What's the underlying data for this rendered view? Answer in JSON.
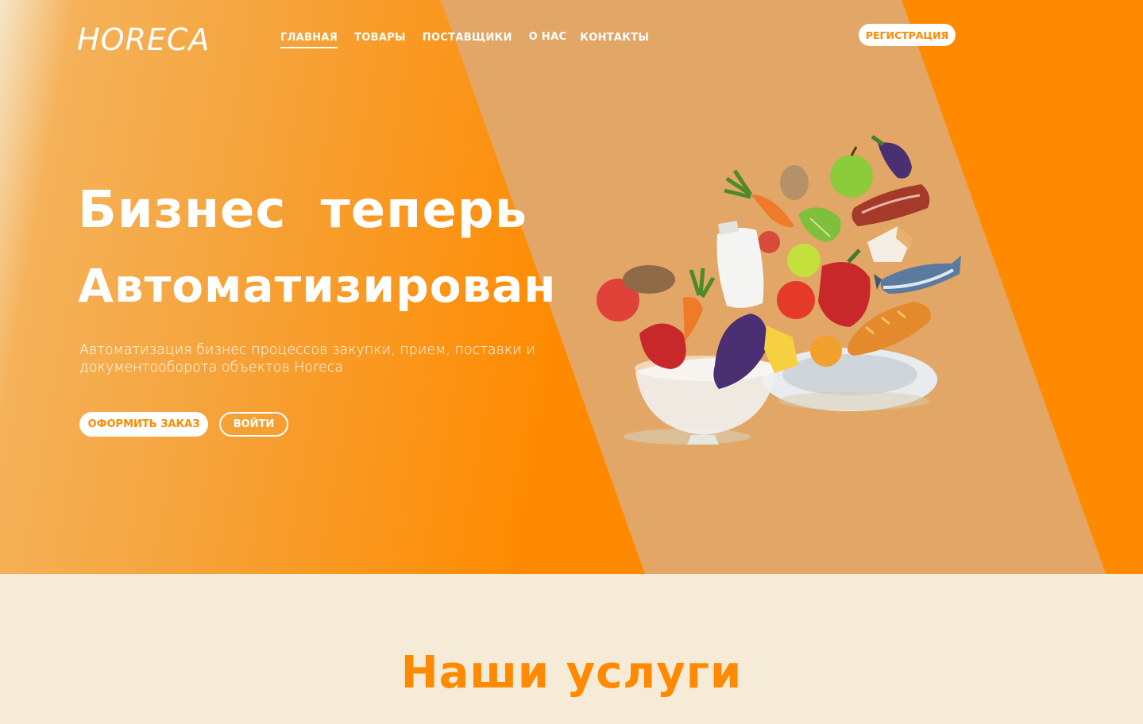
{
  "nav": {
    "logo": "HORECA",
    "items": [
      {
        "label": "ГЛАВНАЯ",
        "active": true
      },
      {
        "label": "ТОВАРЫ"
      },
      {
        "label": "ПОСТАВЩИКИ"
      },
      {
        "label": "О НАС"
      },
      {
        "label": "КОНТАКТЫ"
      }
    ],
    "register_label": "РЕГИСТРАЦИЯ"
  },
  "hero": {
    "title_line1": "Бизнес теперь",
    "title_line2": "Автоматизирован",
    "subtitle": "Автоматизация бизнес процессов закупки, прием, поставки и документооборота объектов Horeca",
    "order_button": "ОФОРМИТЬ ЗАКАЗ",
    "login_button": "ВОЙТИ",
    "illustration": "food-ingredients-illustration"
  },
  "services": {
    "title": "Наши услуги"
  },
  "colors": {
    "accent": "#ff8a00",
    "band": "#e2a766",
    "section_bg": "#f6ebd6",
    "white": "#ffffff"
  }
}
